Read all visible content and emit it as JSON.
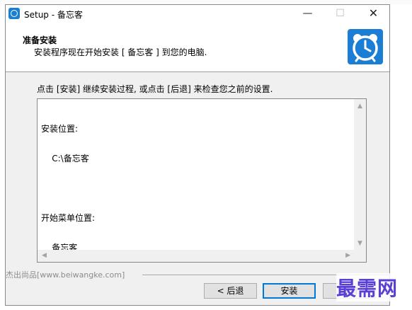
{
  "window": {
    "title": "Setup - 备忘客",
    "minimize_glyph": "—",
    "maximize_glyph": "☐",
    "close_glyph": "✕"
  },
  "header": {
    "title": "准备安装",
    "subtitle": "安装程序现在开始安装 [ 备忘客 ] 到您的电脑.",
    "logo_icon": "alarm-clock-icon"
  },
  "body": {
    "instruction": "点击 [安装] 继续安装过程, 或点击 [后退] 来检查您之前的设置.",
    "info_lines": [
      "安装位置:",
      "    C:\\备忘客",
      "",
      "开始菜单位置:",
      "    备忘客"
    ]
  },
  "footer": {
    "branding": "杰出尚品[www.beiwangke.com]",
    "buttons": {
      "back": "< 后退",
      "install": "安装",
      "cancel": "取消"
    }
  },
  "overlay": {
    "watermark_text": "最需网"
  },
  "colors": {
    "accent": "#0078d7",
    "logo_bg": "#1b7ed4",
    "watermark": "#5a3fd6"
  }
}
